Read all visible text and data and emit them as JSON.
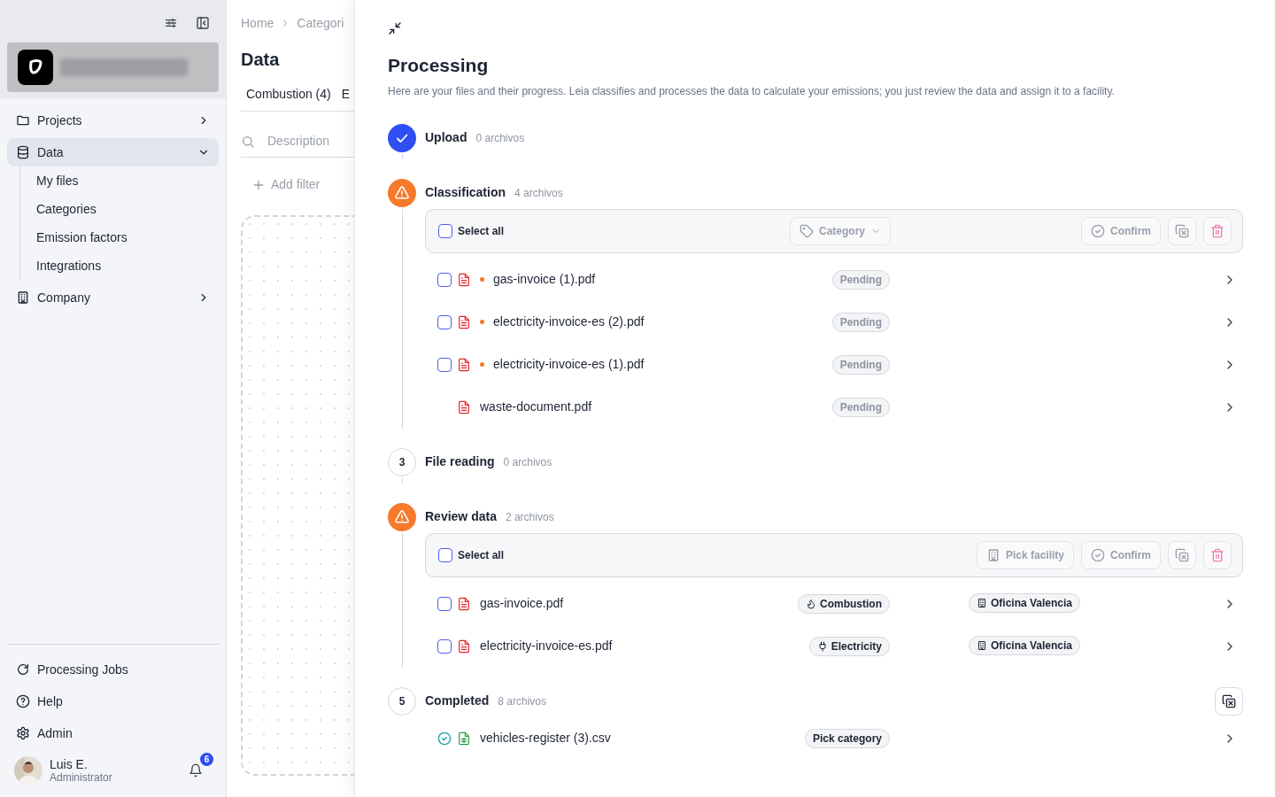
{
  "sidebar": {
    "nav": [
      {
        "label": "Projects",
        "kind": "folder",
        "selected": false,
        "expanded": false
      },
      {
        "label": "Data",
        "kind": "database",
        "selected": true,
        "expanded": true,
        "children": [
          {
            "label": "My files",
            "selected": false
          },
          {
            "label": "Categories",
            "selected": false
          },
          {
            "label": "Emission factors",
            "selected": false
          },
          {
            "label": "Integrations",
            "selected": false
          }
        ]
      },
      {
        "label": "Company",
        "kind": "building",
        "selected": false,
        "expanded": false
      }
    ],
    "footer_nav": [
      {
        "label": "Processing Jobs",
        "kind": "refresh"
      },
      {
        "label": "Help",
        "kind": "help"
      },
      {
        "label": "Admin",
        "kind": "settings"
      }
    ],
    "user": {
      "name": "Luis E.",
      "role": "Administrator",
      "notification_count": "6"
    }
  },
  "data_page": {
    "breadcrumb": [
      "Home",
      "Categori"
    ],
    "title": "Data",
    "tabs": [
      "Combustion (4)",
      "E"
    ],
    "search": {
      "placeholder": "Description"
    },
    "add_filter": "Add filter"
  },
  "processing": {
    "title": "Processing",
    "description": "Here are your files and their progress. Leia classifies and processes the data to calculate your emissions; you just review the data and assign it to a facility.",
    "steps": [
      {
        "kind": "done",
        "title": "Upload",
        "count": "0 archivos"
      },
      {
        "kind": "warning",
        "title": "Classification",
        "count": "4 archivos",
        "toolbar": {
          "select_all": {
            "label": "Select all",
            "checked": false
          },
          "actions": [
            {
              "kind": "category",
              "label": "Category"
            },
            {
              "kind": "confirm",
              "label": "Confirm"
            },
            {
              "kind": "unlink"
            },
            {
              "kind": "delete"
            }
          ]
        },
        "files": [
          {
            "name": "gas-invoice (1).pdf",
            "kind": "pdf",
            "checkbox": {
              "checked": false
            },
            "completed": false,
            "flagged": true,
            "category": {
              "label": "Pending",
              "kind": "pending"
            }
          },
          {
            "name": "electricity-invoice-es (2).pdf",
            "kind": "pdf",
            "checkbox": {
              "checked": false
            },
            "completed": false,
            "flagged": true,
            "category": {
              "label": "Pending",
              "kind": "pending"
            }
          },
          {
            "name": "electricity-invoice-es (1).pdf",
            "kind": "pdf",
            "checkbox": {
              "checked": false
            },
            "completed": false,
            "flagged": true,
            "category": {
              "label": "Pending",
              "kind": "pending"
            }
          },
          {
            "name": "waste-document.pdf",
            "kind": "pdf",
            "completed": false,
            "flagged": false,
            "category": {
              "label": "Pending",
              "kind": "pending"
            }
          }
        ]
      },
      {
        "kind": "pending",
        "number": "3",
        "title": "File reading",
        "count": "0 archivos"
      },
      {
        "kind": "warning",
        "title": "Review data",
        "count": "2 archivos",
        "toolbar": {
          "select_all": {
            "label": "Select all",
            "checked": false
          },
          "actions": [
            {
              "kind": "facility",
              "label": "Pick facility"
            },
            {
              "kind": "confirm",
              "label": "Confirm"
            },
            {
              "kind": "unlink"
            },
            {
              "kind": "delete"
            }
          ]
        },
        "files": [
          {
            "name": "gas-invoice.pdf",
            "kind": "pdf",
            "checkbox": {
              "checked": false
            },
            "completed": false,
            "flagged": false,
            "category": {
              "label": "Combustion",
              "kind": "combustion"
            },
            "facility": "Oficina Valencia"
          },
          {
            "name": "electricity-invoice-es.pdf",
            "kind": "pdf",
            "checkbox": {
              "checked": false
            },
            "completed": false,
            "flagged": false,
            "category": {
              "label": "Electricity",
              "kind": "electricity"
            },
            "facility": "Oficina Valencia"
          }
        ]
      },
      {
        "kind": "pending",
        "number": "5",
        "title": "Completed",
        "count": "8 archivos",
        "header_actions": [
          {
            "kind": "unlink"
          }
        ],
        "files": [
          {
            "name": "vehicles-register (3).csv",
            "kind": "csv",
            "completed": true,
            "flagged": false,
            "category": {
              "label": "Pick category",
              "kind": "neutral"
            }
          }
        ]
      }
    ]
  }
}
